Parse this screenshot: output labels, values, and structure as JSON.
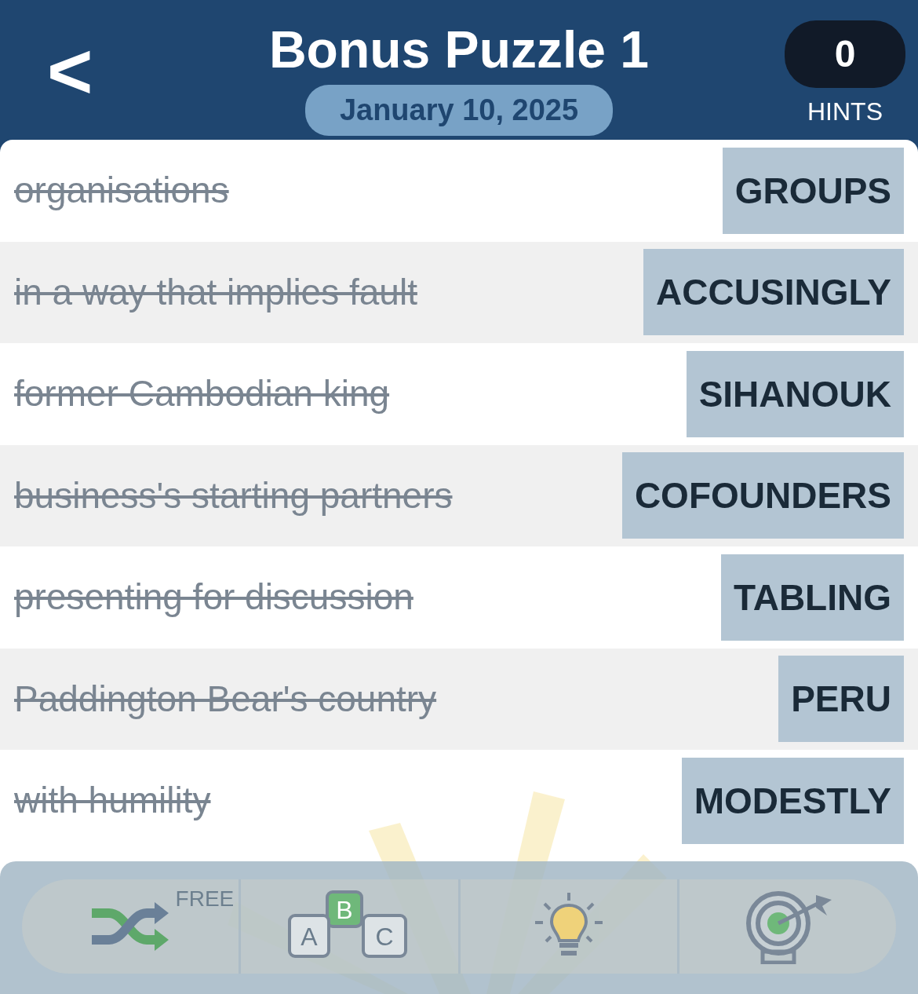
{
  "header": {
    "back": "<",
    "title": "Bonus Puzzle 1",
    "date": "January 10, 2025",
    "hints_count": "0",
    "hints_label": "HINTS"
  },
  "clues": [
    {
      "clue": "organisations",
      "answer": "GROUPS",
      "solved": true
    },
    {
      "clue": "in a way that implies fault",
      "answer": "ACCUSINGLY",
      "solved": true
    },
    {
      "clue": "former Cambodian king",
      "answer": "SIHANOUK",
      "solved": true
    },
    {
      "clue": "business's starting partners",
      "answer": "COFOUNDERS",
      "solved": true
    },
    {
      "clue": "presenting for discussion",
      "answer": "TABLING",
      "solved": true
    },
    {
      "clue": "Paddington Bear's country",
      "answer": "PERU",
      "solved": true
    },
    {
      "clue": "with humility",
      "answer": "MODESTLY",
      "solved": true
    }
  ],
  "toolbar": [
    {
      "kind": "shuffle",
      "badge": "FREE"
    },
    {
      "kind": "letters",
      "letters": [
        "A",
        "B",
        "C"
      ]
    },
    {
      "kind": "hint"
    },
    {
      "kind": "target"
    }
  ]
}
